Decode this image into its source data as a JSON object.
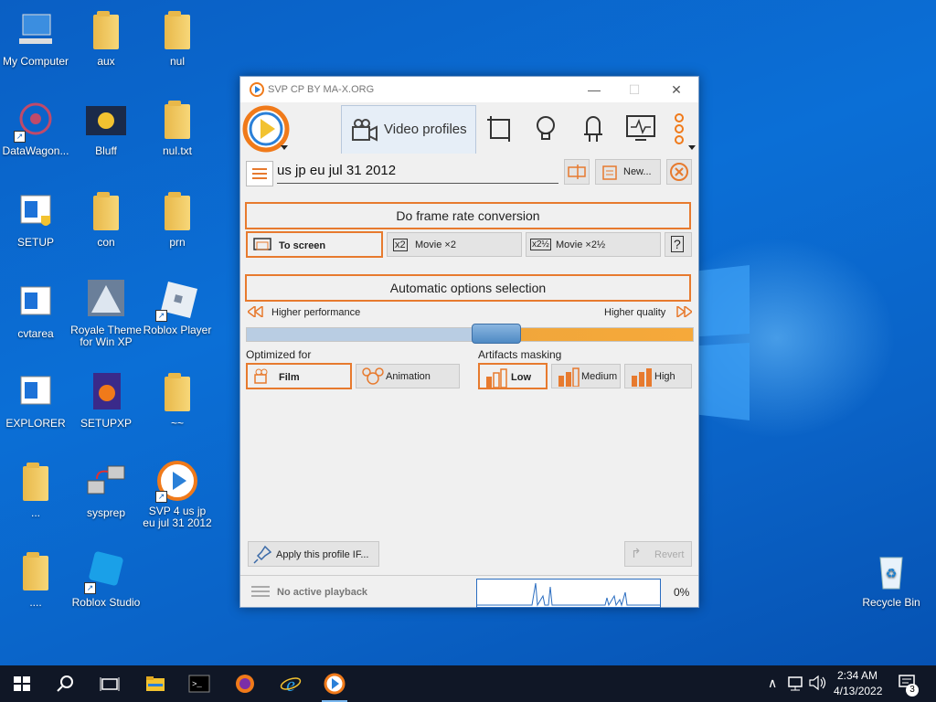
{
  "desktop": {
    "icons": [
      {
        "label": "My Computer"
      },
      {
        "label": "aux"
      },
      {
        "label": "nul"
      },
      {
        "label": "DataWagon..."
      },
      {
        "label": "Bluff"
      },
      {
        "label": "nul.txt"
      },
      {
        "label": "SETUP"
      },
      {
        "label": "con"
      },
      {
        "label": "prn"
      },
      {
        "label": "cvtarea"
      },
      {
        "label": "Royale Theme for Win XP"
      },
      {
        "label": "Roblox Player"
      },
      {
        "label": "EXPLORER"
      },
      {
        "label": "SETUPXP"
      },
      {
        "label": "~~"
      },
      {
        "label": "..."
      },
      {
        "label": "sysprep"
      },
      {
        "label": "SVP 4 us jp eu jul 31 2012"
      },
      {
        "label": "...."
      },
      {
        "label": "Roblox Studio"
      },
      {
        "label": "Recycle Bin"
      }
    ]
  },
  "window": {
    "title": "SVP CP BY MA-X.ORG",
    "active_tab": "Video profiles",
    "profile_name": "us jp eu jul 31 2012",
    "new_button": "New...",
    "frame_rate_header": "Do frame rate conversion",
    "modes": {
      "to_screen": "To screen",
      "movie_x2_badge": "x2",
      "movie_x2": "Movie ×2",
      "movie_x25_badge": "x2½",
      "movie_x25": "Movie ×2½",
      "help": "?"
    },
    "auto_header": "Automatic options selection",
    "higher_performance": "Higher performance",
    "higher_quality": "Higher quality",
    "slider_position": 0.56,
    "optimized_for_label": "Optimized for",
    "film": "Film",
    "animation": "Animation",
    "artifacts_label": "Artifacts masking",
    "low": "Low",
    "medium": "Medium",
    "high": "High",
    "apply_button": "Apply this profile IF...",
    "revert_button": "Revert",
    "status": "No active playback",
    "cpu_percent": "0%"
  },
  "taskbar": {
    "time": "2:34 AM",
    "date": "4/13/2022",
    "notifications": "3"
  },
  "colors": {
    "accent_orange": "#e77a2e",
    "taskbar": "#101726",
    "desktop": "#0b6fd6"
  }
}
